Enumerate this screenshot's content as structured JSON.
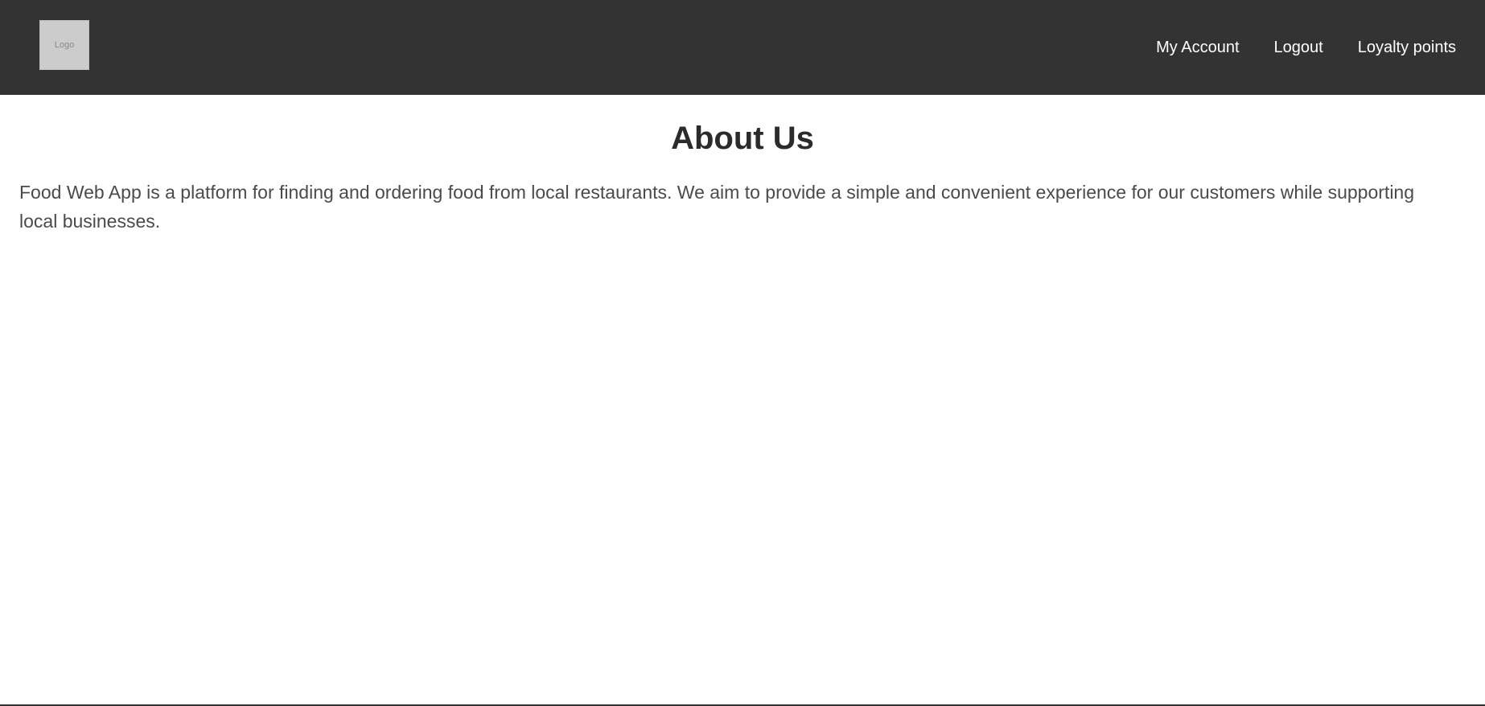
{
  "header": {
    "logo_text": "Logo",
    "nav": {
      "my_account": "My Account",
      "logout": "Logout",
      "loyalty_points": "Loyalty points"
    }
  },
  "main": {
    "title": "About Us",
    "description": "Food Web App is a platform for finding and ordering food from local restaurants. We aim to provide a simple and convenient experience for our customers while supporting local businesses."
  },
  "colors": {
    "header_bg": "#333333",
    "title": "#2b2b2b",
    "body_text": "#4a4a4a"
  }
}
